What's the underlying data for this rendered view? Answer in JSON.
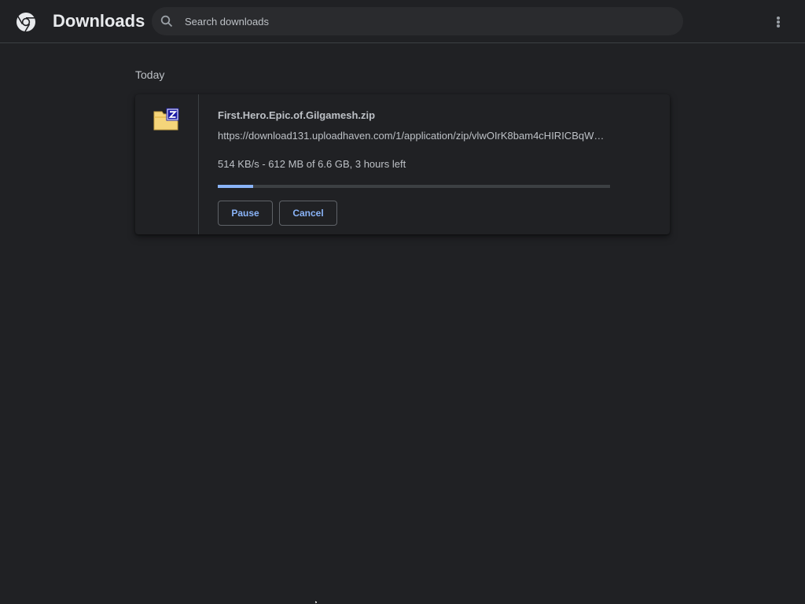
{
  "header": {
    "title": "Downloads",
    "logo_icon": "chrome-logo-icon",
    "search_icon": "search-icon",
    "menu_icon": "more-vert-icon"
  },
  "search": {
    "placeholder": "Search downloads",
    "value": ""
  },
  "section": {
    "label": "Today"
  },
  "download": {
    "file_icon": "zip-archive-icon",
    "file_name": "First.Hero.Epic.of.Gilgamesh.zip",
    "url": "https://download131.uploadhaven.com/1/application/zip/vlwOIrK8bam4cHIRICBqW…",
    "status": "514 KB/s - 612 MB of 6.6 GB, 3 hours left",
    "progress_percent": 9,
    "pause_label": "Pause",
    "cancel_label": "Cancel"
  },
  "colors": {
    "background": "#202124",
    "accent": "#8ab4f8",
    "text_primary": "#e8eaed",
    "text_secondary": "#bdc1c6",
    "divider": "#3c4043",
    "zip_folder": "#f5d57a",
    "zip_badge": "#1a1aa6"
  }
}
